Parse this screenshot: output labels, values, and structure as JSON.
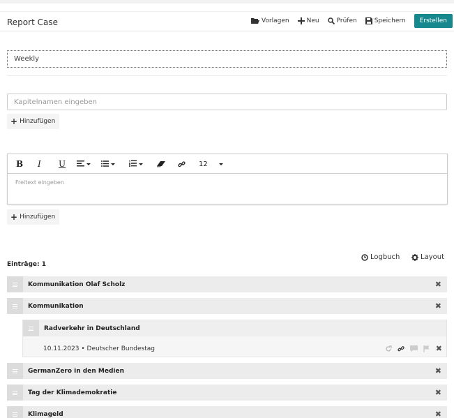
{
  "header": {
    "title": "Report Case",
    "toolbar": {
      "templates_label": "Vorlagen",
      "new_label": "Neu",
      "check_label": "Prüfen",
      "save_label": "Speichern",
      "create_label": "Erstellen"
    }
  },
  "report": {
    "name_value": "Weekly"
  },
  "chapter": {
    "placeholder": "Kapitelnamen eingeben",
    "add_label": "Hinzufügen"
  },
  "editor": {
    "font_size": "12",
    "placeholder": "Freitext eingeben",
    "add_label": "Hinzufügen",
    "tools": [
      "bold-icon",
      "italic-icon",
      "underline-icon",
      "align-icon",
      "bullet-list-icon",
      "numbered-list-icon",
      "eraser-icon",
      "link-icon"
    ]
  },
  "entries": {
    "count_label": "Einträge: 1",
    "logbook_label": "Logbuch",
    "layout_label": "Layout",
    "items": [
      {
        "label": "Kommunikation Olaf Scholz"
      },
      {
        "label": "Kommunikation"
      },
      {
        "label": "GermanZero in den Medien"
      },
      {
        "label": "Tag der Klimademokratie"
      },
      {
        "label": "Klimageld"
      }
    ],
    "sub_item": {
      "label": "Radverkehr in Deutschland",
      "meta": "10.11.2023 • Deutscher Bundestag"
    }
  },
  "colors": {
    "accent": "#17888d",
    "row_bg": "#ececec",
    "handle_bg": "#dcdcdc"
  }
}
